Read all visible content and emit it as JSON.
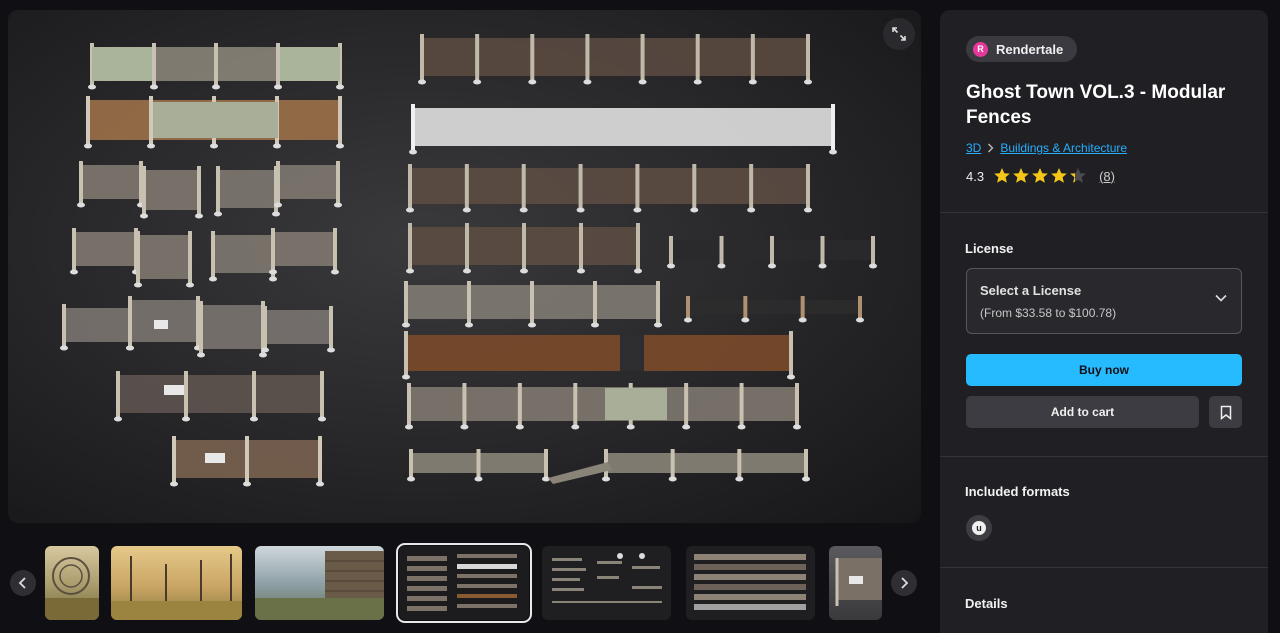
{
  "product": {
    "seller": "Rendertale",
    "title": "Ghost Town VOL.3 - Modular Fences",
    "breadcrumb": [
      "3D",
      "Buildings & Architecture"
    ],
    "rating": "4.3",
    "rating_value": 4.3,
    "rating_max": 5,
    "review_count": "(8)"
  },
  "license": {
    "heading": "License",
    "select_label": "Select a License",
    "price_range": "(From $33.58 to $100.78)"
  },
  "actions": {
    "buy": "Buy now",
    "cart": "Add to cart"
  },
  "formats": {
    "heading": "Included formats",
    "items": [
      "unreal-engine-icon"
    ]
  },
  "details": {
    "heading": "Details"
  },
  "gallery": {
    "thumbnail_count": 7,
    "active_index": 3
  },
  "colors": {
    "accent": "#26bbff",
    "star": "#f5c518",
    "link": "#27aefc"
  }
}
